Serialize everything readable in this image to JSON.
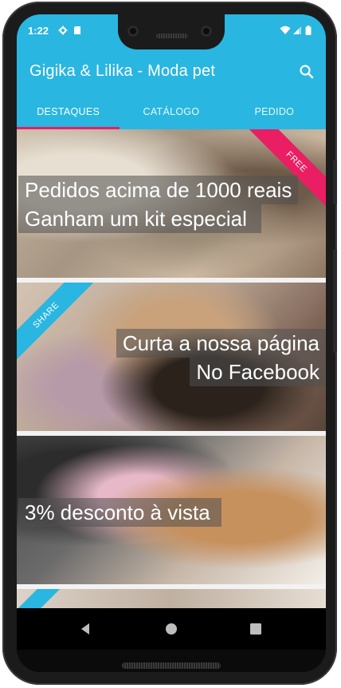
{
  "status_bar": {
    "time": "1:22",
    "icons": [
      "gear-icon",
      "sd-card-icon",
      "wifi-icon",
      "signal-icon",
      "battery-icon"
    ]
  },
  "app_bar": {
    "title": "Gigika & Lilika - Moda pet",
    "search_icon": "search-icon",
    "color": "#29b6e0"
  },
  "tabs": [
    {
      "label": "DESTAQUES",
      "active": true
    },
    {
      "label": "CATÁLOGO",
      "active": false
    },
    {
      "label": "PEDIDO",
      "active": false
    }
  ],
  "accent_color": "#e91e63",
  "cards": [
    {
      "ribbon": "FREE",
      "ribbon_color": "#e91e63",
      "line1": "Pedidos acima de 1000 reais",
      "line2": "Ganham um kit especial"
    },
    {
      "ribbon": "SHARE",
      "ribbon_color": "#29b6e0",
      "line1": "Curta a nossa página",
      "line2": "No Facebook"
    },
    {
      "ribbon": "",
      "line1": "3% desconto à vista"
    },
    {
      "ribbon": "",
      "line1": ""
    }
  ],
  "nav_bar": {
    "back_icon": "back-triangle-icon",
    "home_icon": "home-circle-icon",
    "recents_icon": "recents-square-icon"
  }
}
